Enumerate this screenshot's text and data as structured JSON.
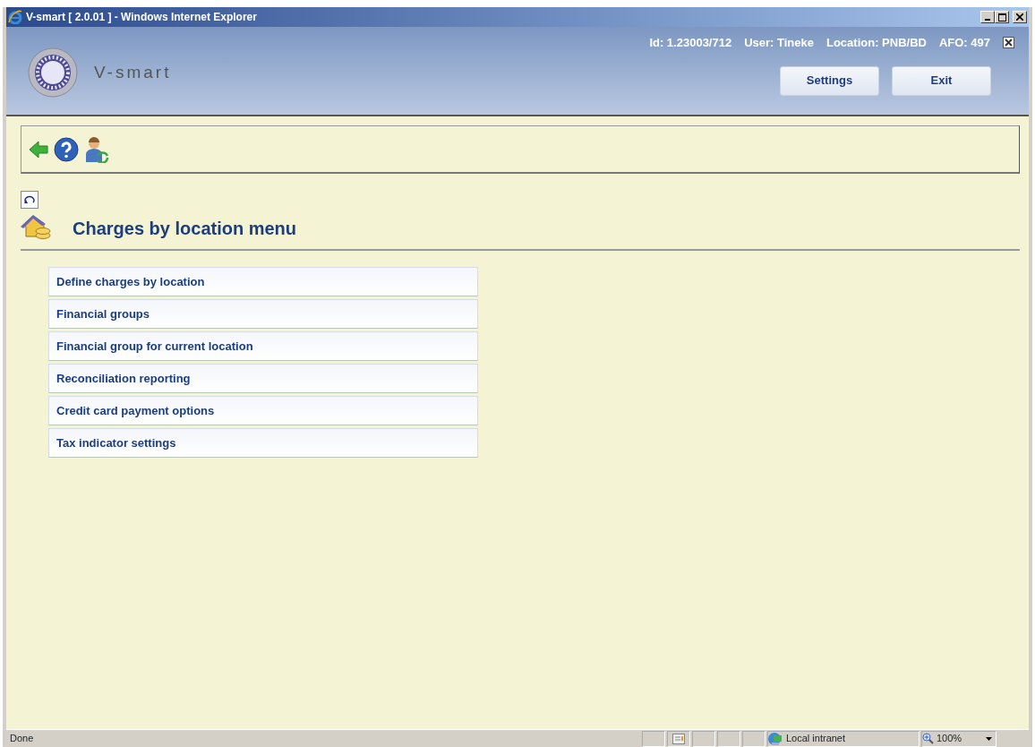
{
  "window": {
    "title": "V-smart [ 2.0.01 ] - Windows Internet Explorer"
  },
  "header": {
    "logo_text": "V-smart",
    "info": [
      "Id: 1.23003/712",
      "User: Tineke",
      "Location: PNB/BD",
      "AFO: 497"
    ],
    "buttons": [
      "Settings",
      "Exit"
    ]
  },
  "page": {
    "title": "Charges by location menu"
  },
  "menu": [
    "Define charges by location",
    "Financial groups",
    "Financial group for current location",
    "Reconciliation reporting",
    "Credit card payment options",
    "Tax indicator settings"
  ],
  "status_bar": {
    "text": "Done",
    "zone": "Local intranet",
    "zoom": "100%"
  }
}
